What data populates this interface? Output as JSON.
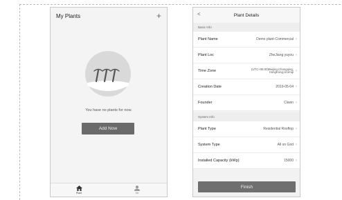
{
  "plants_list": {
    "title": "My Plants",
    "add_icon": "+",
    "empty_message": "You have no plants for now.",
    "add_now_label": "Add Now",
    "tabs": [
      {
        "label": "Plant",
        "icon": "home-icon",
        "active": true
      },
      {
        "label": "Me",
        "icon": "person-icon",
        "active": false
      }
    ]
  },
  "plant_details": {
    "back_icon": "<",
    "title": "Plant Details",
    "sections": {
      "basic": "Basic Info",
      "system": "System Info"
    },
    "rows": [
      {
        "label": "Plant Name",
        "value": "Demo plant-Commercial"
      },
      {
        "label": "Plant Loc",
        "value": "ZheJiang yuyou"
      },
      {
        "label": "Time Zone",
        "value_line1": "(UTC+08:00)Beijing,Chongqing,",
        "value_line2": "HongKong,Urumqi"
      },
      {
        "label": "Creation Date",
        "value": "2019-05-04"
      },
      {
        "label": "Founder",
        "value": "Clavin"
      },
      {
        "label": "Plant Type",
        "value": "Residential Rooftop"
      },
      {
        "label": "System Type",
        "value": "All on Grid"
      },
      {
        "label": "Installed Capacity (kWp)",
        "value": "15000"
      }
    ],
    "finish_label": "Finish"
  },
  "colors": {
    "button_bg": "#6a6a6a",
    "page_bg": "#f3f3f3"
  }
}
